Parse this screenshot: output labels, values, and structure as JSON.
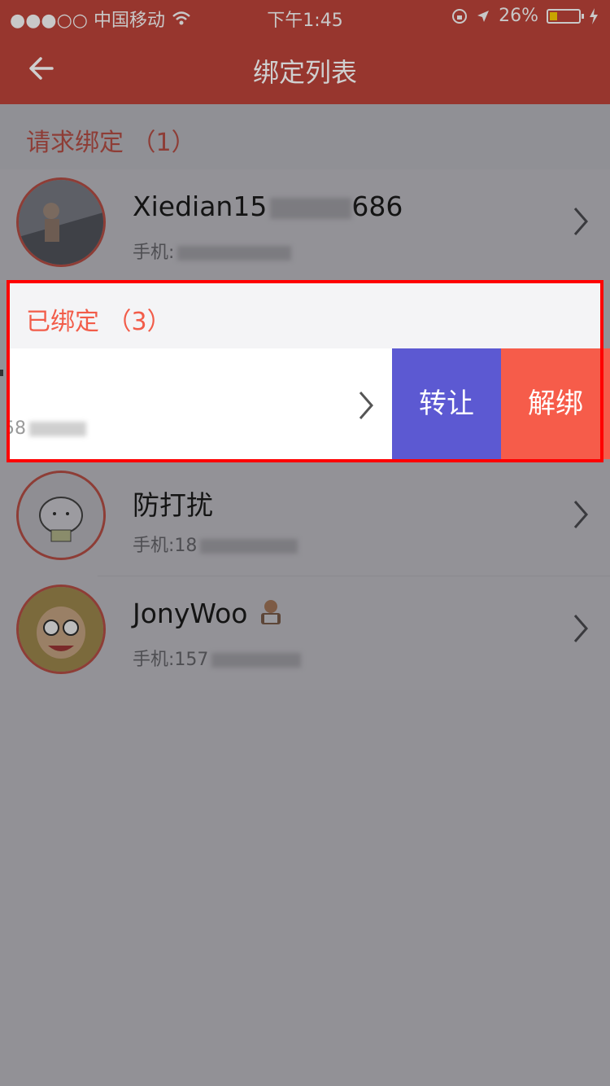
{
  "status": {
    "carrier": "●●●○○ 中国移动",
    "time": "下午1:45",
    "battery_percent": "26%",
    "battery_level": 0.26,
    "battery_color": "#c9a400"
  },
  "nav": {
    "title": "绑定列表",
    "back_icon": "back-arrow-icon"
  },
  "requests": {
    "header": "请求绑定 （1）",
    "items": [
      {
        "name_prefix": "Xiedian15",
        "name_suffix": "686",
        "phone_label": "手机:"
      }
    ]
  },
  "bound": {
    "header": "已绑定 （3）",
    "swiped_item": {
      "phone_partial": "58"
    },
    "actions": {
      "transfer": "转让",
      "unbind": "解绑"
    },
    "items": [
      {
        "name": "防打扰",
        "phone": "手机:18"
      },
      {
        "name": "JonyWoo",
        "phone": "手机:157"
      }
    ]
  },
  "colors": {
    "navbar": "#97362E",
    "accent_red": "#F65C4A",
    "transfer_purple": "#5C59D2"
  }
}
